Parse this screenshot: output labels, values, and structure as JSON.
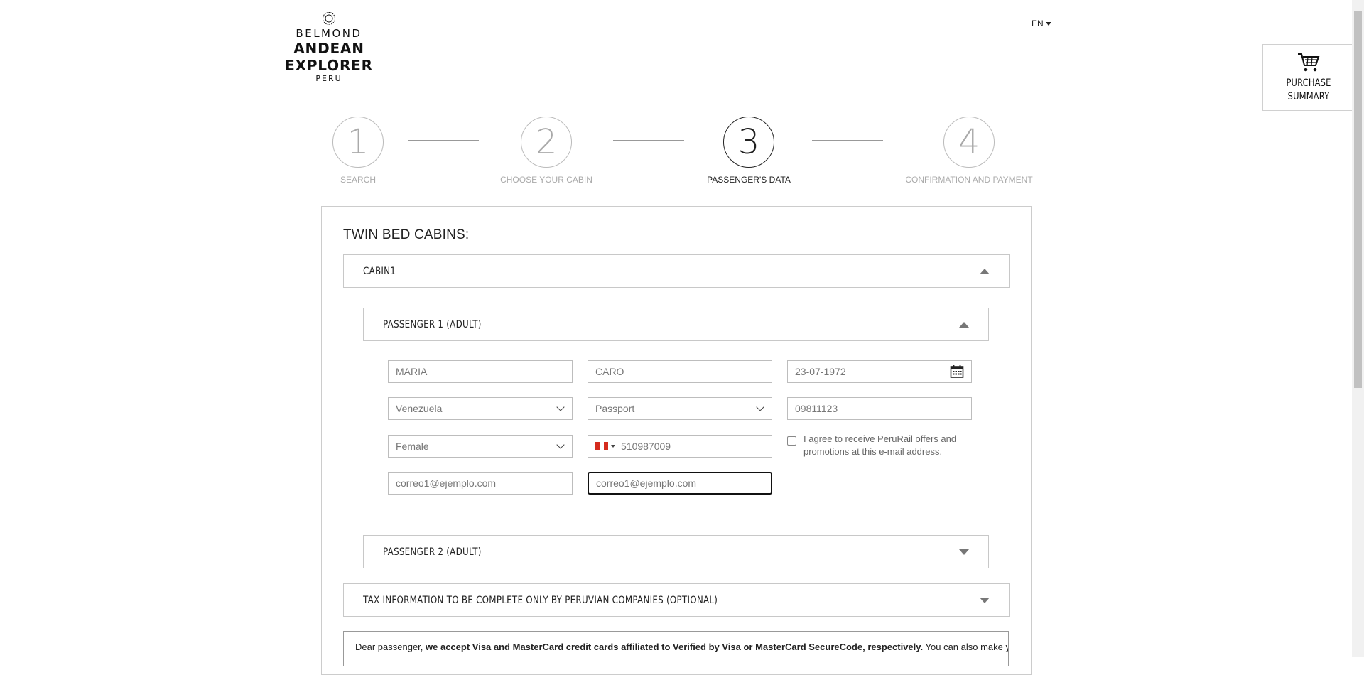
{
  "header": {
    "brand": "BELMOND",
    "name": "ANDEAN EXPLORER",
    "subtitle": "PERU",
    "language": "EN",
    "purchase_summary_label": "PURCHASE\nSUMMARY"
  },
  "steps": [
    {
      "number": "1",
      "label": "SEARCH"
    },
    {
      "number": "2",
      "label": "CHOOSE YOUR CABIN"
    },
    {
      "number": "3",
      "label": "PASSENGER'S DATA"
    },
    {
      "number": "4",
      "label": "CONFIRMATION AND PAYMENT"
    }
  ],
  "active_step": 3,
  "section_title": "TWIN BED CABINS:",
  "cabin": {
    "title": "CABIN1",
    "passengers": [
      {
        "title": "PASSENGER 1 (ADULT)",
        "first_name": "MARIA",
        "last_name": "CARO",
        "birth_date": "23-07-1972",
        "nationality": "Venezuela",
        "document_type": "Passport",
        "document_number": "09811123",
        "gender": "Female",
        "phone": "510987009",
        "email": "correo1@ejemplo.com",
        "email_confirm": "correo1@ejemplo.com",
        "consent_text": "I agree to receive PeruRail offers and promotions at this e-mail address."
      },
      {
        "title": "PASSENGER 2 (ADULT)"
      }
    ]
  },
  "tax_section_title": "TAX INFORMATION TO BE COMPLETE ONLY BY PERUVIAN COMPANIES (OPTIONAL)",
  "notice": {
    "prefix": "Dear passenger, ",
    "bold": "we accept Visa and MasterCard credit cards affiliated to Verified by Visa or MasterCard SecureCode, respectively.",
    "suffix": " You can also make your"
  },
  "colors": {
    "active_step": "#222222",
    "inactive_step": "#aaaaaa",
    "flag_red": "#d52b1e"
  }
}
